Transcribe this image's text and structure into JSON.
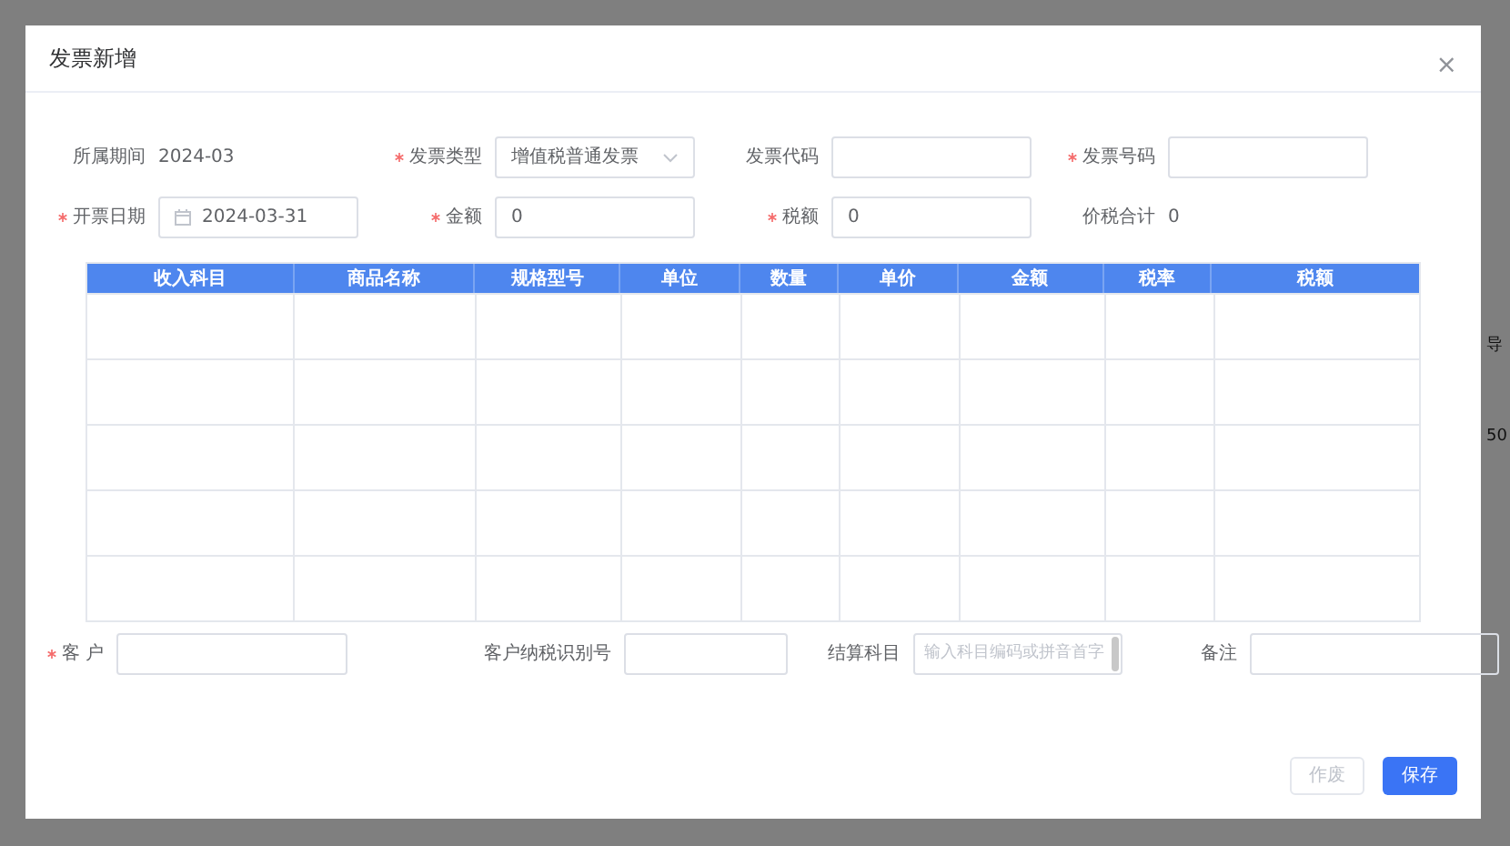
{
  "background": {
    "texts": [
      "导",
      "50"
    ]
  },
  "dialog": {
    "title": "发票新增",
    "close": "×",
    "form_rows": [
      [
        {
          "label": "所属期间",
          "required": false,
          "kind": "static",
          "value": "2024-03"
        },
        {
          "label": "发票类型",
          "required": true,
          "kind": "select",
          "value": "增值税普通发票"
        },
        {
          "label": "发票代码",
          "required": false,
          "kind": "input"
        },
        {
          "label": "发票号码",
          "required": true,
          "kind": "input"
        }
      ],
      [
        {
          "label": "开票日期",
          "required": true,
          "kind": "date",
          "value": "2024-03-31"
        },
        {
          "label": "金额",
          "required": true,
          "kind": "input",
          "value": "0"
        },
        {
          "label": "税额",
          "required": true,
          "kind": "input",
          "value": "0"
        },
        {
          "label": "价税合计",
          "required": false,
          "kind": "static",
          "value": "0"
        }
      ]
    ],
    "table": {
      "columns": [
        "收入科目",
        "商品名称",
        "规格型号",
        "单位",
        "数量",
        "单价",
        "金额",
        "税率",
        "税额"
      ]
    },
    "bottom_fields": [
      {
        "label": "客 户",
        "required": true,
        "kind": "input"
      },
      {
        "label": "客户纳税识别号",
        "required": false,
        "kind": "input"
      },
      {
        "label": "结算科目",
        "required": false,
        "kind": "combo",
        "placeholder": "输入科目编码或拼音首字"
      },
      {
        "label": "备注",
        "required": false,
        "kind": "input"
      }
    ],
    "buttons": [
      {
        "label": "作废",
        "primary": false
      },
      {
        "label": "保存",
        "primary": true
      }
    ]
  }
}
